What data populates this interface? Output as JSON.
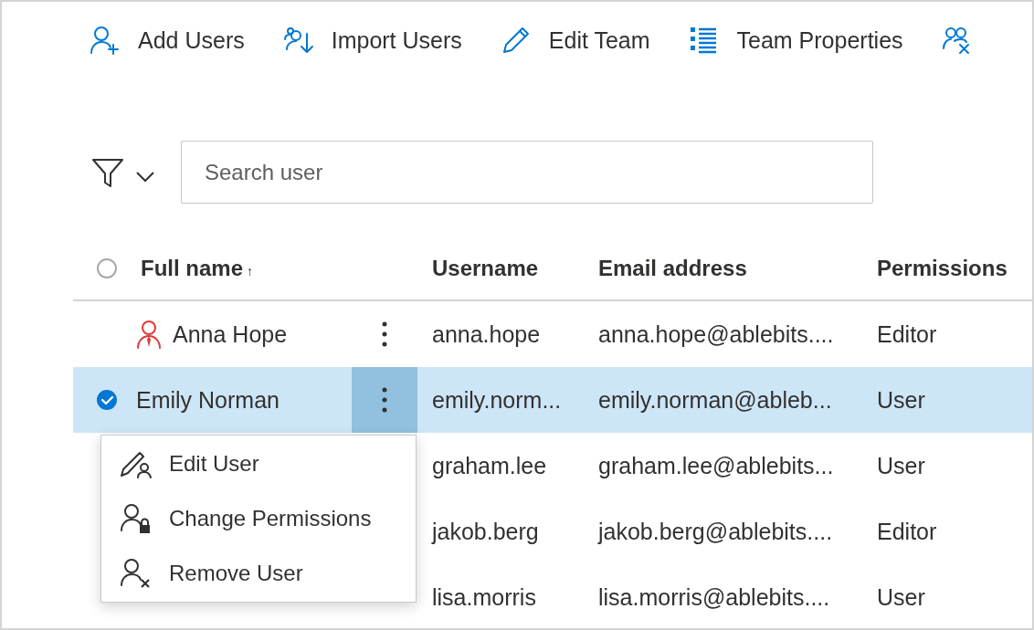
{
  "toolbar": [
    {
      "label": "Add Users"
    },
    {
      "label": "Import Users"
    },
    {
      "label": "Edit Team"
    },
    {
      "label": "Team Properties"
    },
    {
      "kind": "icon"
    }
  ],
  "filter": {
    "expanded": false
  },
  "search": {
    "placeholder": "Search user"
  },
  "table": {
    "select_all": {
      "checked": false
    },
    "columns": [
      {
        "label": "Full name",
        "sort": "↑"
      },
      {
        "label": "Username"
      },
      {
        "label": "Email address"
      },
      {
        "label": "Permissions"
      }
    ],
    "rows": [
      {
        "name": "Anna Hope",
        "kind": "owner",
        "selected": false,
        "menu_open": false,
        "username": "anna.hope",
        "email": "anna.hope@ablebits....",
        "permissions": "Editor"
      },
      {
        "name": "Emily Norman",
        "kind": "member",
        "selected": true,
        "menu_open": true,
        "username": "emily.norm...",
        "email": "emily.norman@ableb...",
        "permissions": "User"
      },
      {
        "selected": false,
        "username": "graham.lee",
        "email": "graham.lee@ablebits...",
        "permissions": "User"
      },
      {
        "selected": false,
        "username": "jakob.berg",
        "email": "jakob.berg@ablebits....",
        "permissions": "Editor"
      },
      {
        "selected": false,
        "username": "lisa.morris",
        "email": "lisa.morris@ablebits....",
        "permissions": "User"
      }
    ]
  },
  "context_menu": {
    "items": [
      {
        "label": "Edit User",
        "kind": "edit"
      },
      {
        "label": "Change Permissions",
        "kind": "permissions"
      },
      {
        "label": "Remove User",
        "kind": "remove"
      }
    ]
  }
}
